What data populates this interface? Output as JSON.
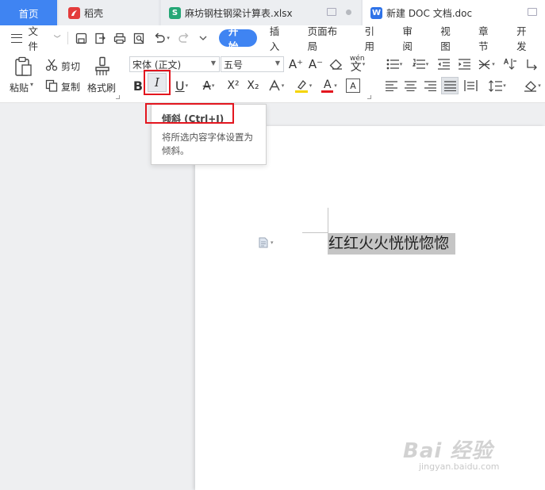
{
  "tabs": {
    "home": "首页",
    "daoke": "稻壳",
    "xlsx": "麻坊钢柱钢梁计算表.xlsx",
    "doc": "新建 DOC 文档.doc",
    "xlsx_icon_letter": "S",
    "doc_icon_letter": "W"
  },
  "menu": {
    "file": "文件",
    "tabs": [
      "开始",
      "插入",
      "页面布局",
      "引用",
      "审阅",
      "视图",
      "章节",
      "开发"
    ],
    "active_tab": "开始"
  },
  "ribbon": {
    "paste": "粘贴",
    "cut": "剪切",
    "copy": "复制",
    "format_painter": "格式刷",
    "font_name": "宋体 (正文)",
    "font_size": "五号",
    "bold": "B",
    "italic": "I",
    "underline": "U",
    "strike": "A",
    "superscript": "X²",
    "subscript": "X₂",
    "font_color": "A",
    "char_border": "A",
    "phonetic": "wén",
    "grow_font": "A⁺",
    "shrink_font": "A⁻"
  },
  "tooltip": {
    "title": "倾斜 (Ctrl+I)",
    "description": "将所选内容字体设置为倾斜。"
  },
  "document": {
    "selected_text": "红红火火恍恍惚惚"
  },
  "watermark": {
    "main": "Bai 经验",
    "sub": "jingyan.baidu.com"
  },
  "colors": {
    "accent": "#3f84f2",
    "highlight_red": "#e3161f",
    "highlight_yellow": "#f5d400",
    "font_color_red": "#e3161f"
  }
}
